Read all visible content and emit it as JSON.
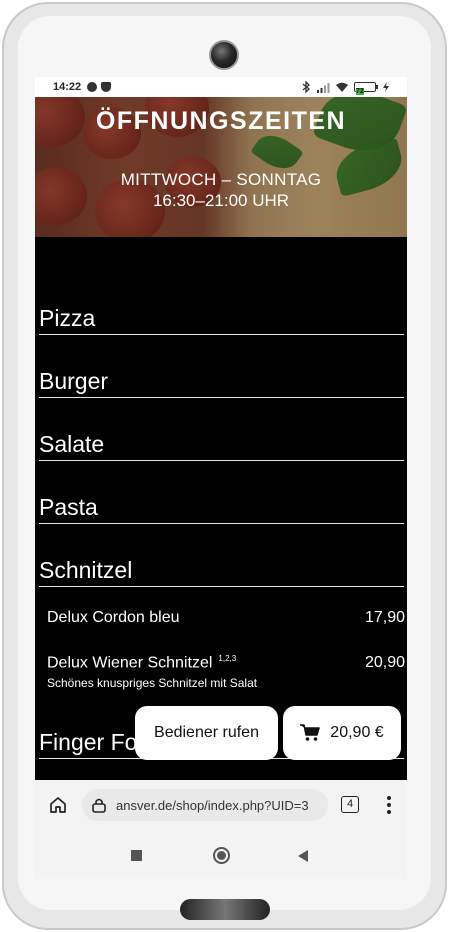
{
  "status_bar": {
    "time": "14:22",
    "battery": "72"
  },
  "banner": {
    "title": "ÖFFNUNGSZEITEN",
    "days": "MITTWOCH – SONNTAG",
    "hours": "16:30–21:00 UHR"
  },
  "categories": [
    {
      "label": "Pizza"
    },
    {
      "label": "Burger"
    },
    {
      "label": "Salate"
    },
    {
      "label": "Pasta"
    },
    {
      "label": "Schnitzel"
    },
    {
      "label": "Finger Food"
    }
  ],
  "items": [
    {
      "name": "Delux Cordon bleu",
      "price": "17,90",
      "superscript": "",
      "description": ""
    },
    {
      "name": "Delux Wiener Schnitzel",
      "price": "20,90",
      "superscript": "1,2,3",
      "description": "Schönes knuspriges Schnitzel mit Salat"
    }
  ],
  "actions": {
    "waiter_label": "Bediener rufen",
    "cart_total": "20,90 €"
  },
  "browser": {
    "url": "ansver.de/shop/index.php?UID=3",
    "tab_count": "4"
  },
  "icons": {
    "home": "home-icon",
    "lock": "lock-icon",
    "cart": "cart-icon",
    "menu": "more-vert-icon"
  },
  "colors": {
    "page_background": "#000000",
    "battery_fill": "#3cb043",
    "button_background": "#ffffff"
  }
}
